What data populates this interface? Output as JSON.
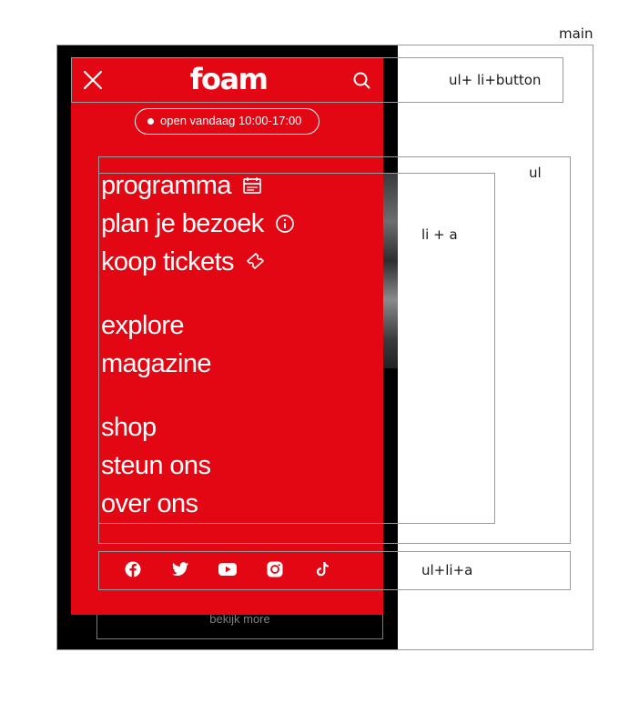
{
  "header": {
    "logo": "foam",
    "opening_hours": "open vandaag 10:00-17:00"
  },
  "nav": {
    "primary": [
      {
        "label": "programma",
        "icon": "calendar-icon"
      },
      {
        "label": "plan je bezoek",
        "icon": "info-icon"
      },
      {
        "label": "koop tickets",
        "icon": "ticket-icon"
      }
    ],
    "secondary": [
      {
        "label": "explore"
      },
      {
        "label": "magazine"
      }
    ],
    "tertiary": [
      {
        "label": "shop"
      },
      {
        "label": "steun ons"
      },
      {
        "label": "over ons"
      }
    ]
  },
  "social": [
    "facebook-icon",
    "twitter-icon",
    "youtube-icon",
    "instagram-icon",
    "tiktok-icon"
  ],
  "footer": {
    "button_label": "bekijk more"
  },
  "annotations": {
    "main": "main",
    "header_list": "ul+ li+button",
    "nav_list": "ul",
    "nav_item": "li + a",
    "social_list": "ul+li+a"
  },
  "colors": {
    "brand_red": "#e30613",
    "frame": "#000000",
    "text": "#ffffff"
  }
}
